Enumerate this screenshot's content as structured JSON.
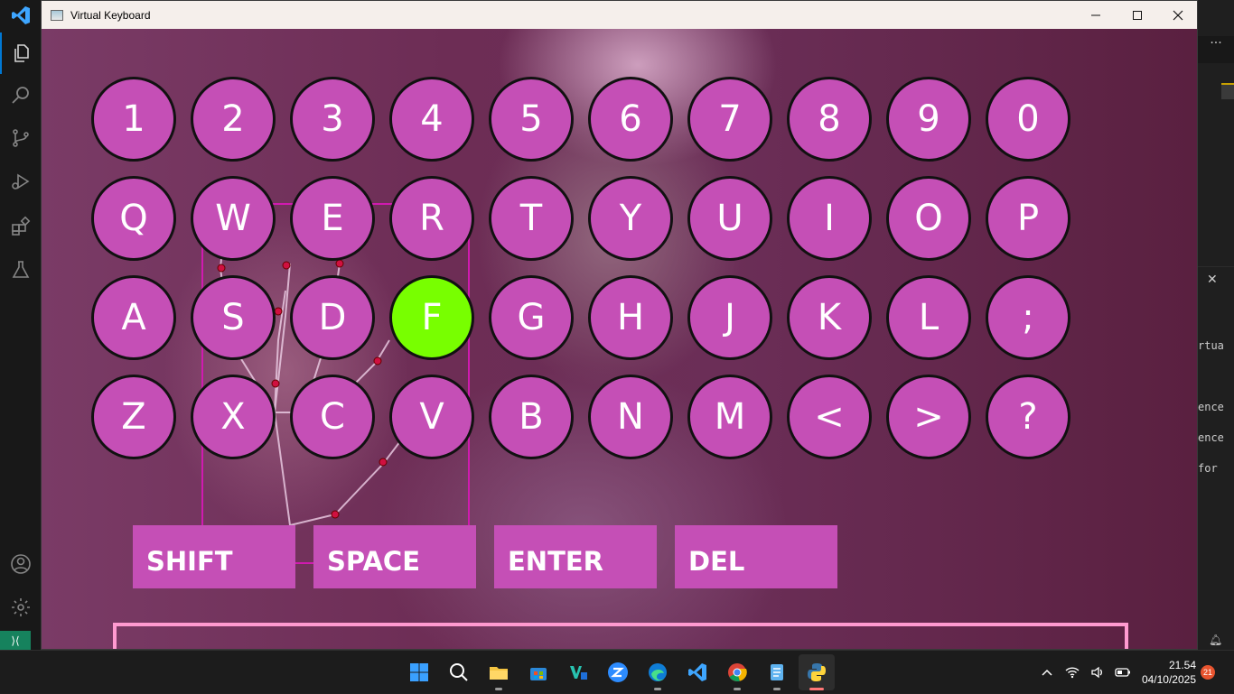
{
  "window": {
    "title": "Virtual Keyboard"
  },
  "keyboard": {
    "rows": [
      [
        "1",
        "2",
        "3",
        "4",
        "5",
        "6",
        "7",
        "8",
        "9",
        "0"
      ],
      [
        "Q",
        "W",
        "E",
        "R",
        "T",
        "Y",
        "U",
        "I",
        "O",
        "P"
      ],
      [
        "A",
        "S",
        "D",
        "F",
        "G",
        "H",
        "J",
        "K",
        "L",
        ";"
      ],
      [
        "Z",
        "X",
        "C",
        "V",
        "B",
        "N",
        "M",
        "<",
        ">",
        "?"
      ]
    ],
    "highlighted_key": "F",
    "key_color": "#c54fb6",
    "highlight_color": "#78ff00",
    "special_keys": [
      "SHIFT",
      "SPACE",
      "ENTER",
      "DEL"
    ],
    "typed_text": ""
  },
  "vscode_right": {
    "more": "···",
    "close": "✕",
    "snippets": [
      "rtua",
      "ence",
      "ence",
      "for"
    ]
  },
  "taskbar": {
    "time": "21.54",
    "date": "04/10/2025",
    "notification_count": "21",
    "apps": [
      "start-icon",
      "search-icon",
      "file-explorer-icon",
      "microsoft-store-icon",
      "visual-studio-icon",
      "zoom-icon",
      "edge-icon",
      "vscode-icon",
      "chrome-icon",
      "notepad-icon",
      "python-icon"
    ]
  }
}
